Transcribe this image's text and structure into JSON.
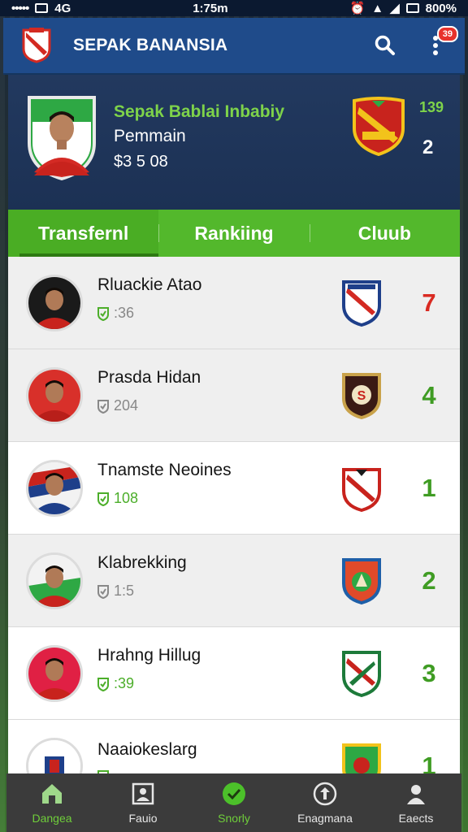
{
  "status_bar": {
    "left_text": "•••••",
    "carrier": "4G",
    "time": "1:75m",
    "battery": "800%"
  },
  "app_bar": {
    "title": "SEPAK BANANSIA",
    "notification_count": "39"
  },
  "hero": {
    "title": "Sepak Bablai Inbabiy",
    "subtitle": "Pemmain",
    "price": "$3 5 08",
    "stat_top": "139",
    "stat_bottom": "2"
  },
  "tabs": [
    {
      "label": "Transfernl"
    },
    {
      "label": "Rankiing"
    },
    {
      "label": "Cluub"
    }
  ],
  "players": [
    {
      "name": "Rluackie Atao",
      "meta": ":36",
      "rank": "7",
      "rank_color": "#d92a22",
      "meta_icon": "shield-check-icon"
    },
    {
      "name": "Prasda Hidan",
      "meta": "204",
      "rank": "4",
      "rank_color": "#3f9c23",
      "meta_icon": "shield-icon"
    },
    {
      "name": "Tnamste Neoines",
      "meta": "108",
      "rank": "1",
      "rank_color": "#3f9c23",
      "meta_icon": "shield-check-icon"
    },
    {
      "name": "Klabrekking",
      "meta": "1:5",
      "rank": "2",
      "rank_color": "#3f9c23",
      "meta_icon": "shield-icon"
    },
    {
      "name": "Hrahng Hillug",
      "meta": ":39",
      "rank": "3",
      "rank_color": "#3f9c23",
      "meta_icon": "shield-check-icon"
    },
    {
      "name": "Naaiokeslarg",
      "meta": "",
      "rank": "1",
      "rank_color": "#3f9c23",
      "meta_icon": "shield-check-icon"
    }
  ],
  "bottom_nav": [
    {
      "label": "Dangea",
      "icon": "home-icon",
      "active": true
    },
    {
      "label": "Fauio",
      "icon": "photo-frame-icon",
      "active": false
    },
    {
      "label": "Snorly",
      "icon": "check-circle-icon",
      "active": true
    },
    {
      "label": "Enagmana",
      "icon": "gear-circle-icon",
      "active": false
    },
    {
      "label": "Eaects",
      "icon": "person-icon",
      "active": false
    }
  ],
  "colors": {
    "app_bar": "#1f4b8a",
    "hero_bg": "#22395f",
    "accent_green": "#53b82c",
    "rank_red": "#d92a22",
    "rank_green": "#3f9c23",
    "nav_bg": "#3b3b3b"
  }
}
